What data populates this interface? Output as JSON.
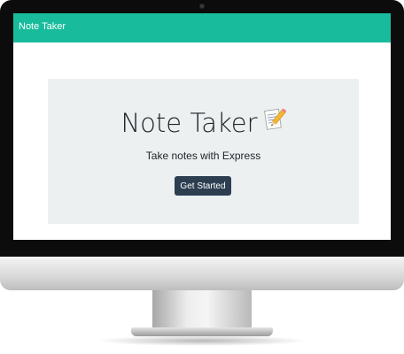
{
  "navbar": {
    "brand": "Note Taker"
  },
  "hero": {
    "title": "Note Taker",
    "title_icon": "memo-icon",
    "subtitle": "Take notes with Express",
    "cta_label": "Get Started"
  },
  "colors": {
    "navbar": "#18bc9c",
    "jumbotron": "#ecf0f1",
    "button": "#2c3e50",
    "text": "#212529"
  }
}
